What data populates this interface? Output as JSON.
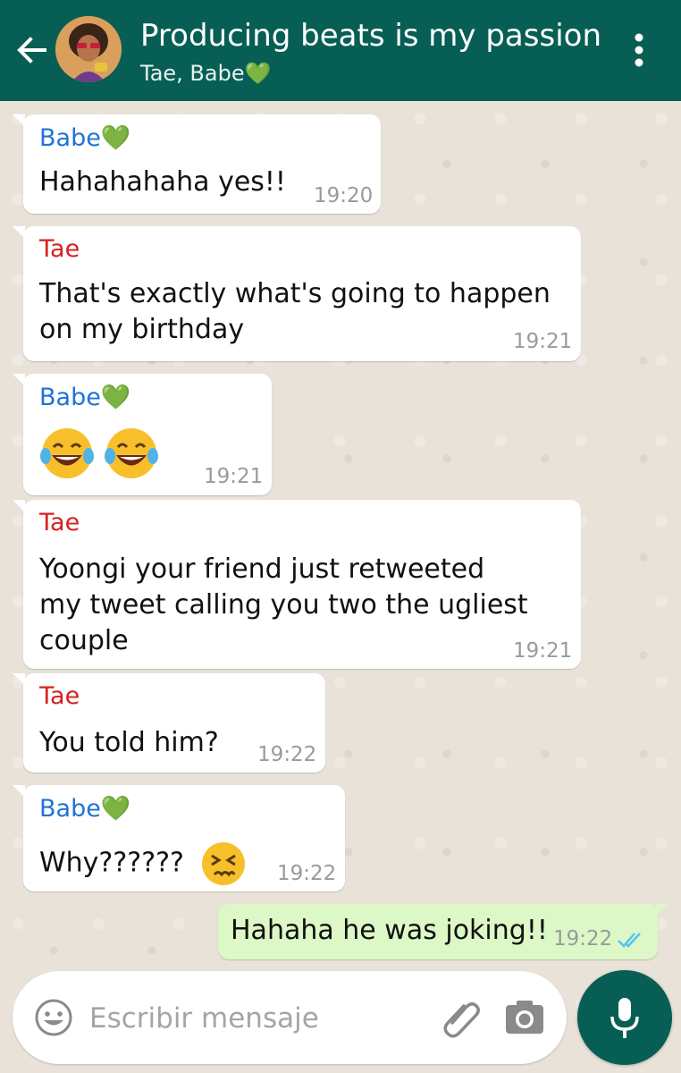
{
  "header": {
    "title": "Producing beats is my passion",
    "participants": "Tae, Babe💚"
  },
  "colors": {
    "header": "#075e54",
    "outgoing_bubble": "#dcf8c6",
    "incoming_bubble": "#ffffff",
    "sender_babe": "#1f73d6",
    "sender_tae": "#d5211f",
    "read_ticks": "#4fc3f7"
  },
  "messages": [
    {
      "sender": "Babe💚",
      "lines": [
        "Hahahahaha yes!!"
      ],
      "time": "19:20"
    },
    {
      "sender": "Tae",
      "lines": [
        "That's exactly what's going to happen",
        "on my birthday"
      ],
      "time": "19:21"
    },
    {
      "sender": "Babe💚",
      "emoji": "😂😂",
      "time": "19:21"
    },
    {
      "sender": "Tae",
      "lines": [
        "Yoongi your friend just retweeted",
        "my tweet calling you two the ugliest",
        "couple"
      ],
      "time": "19:21"
    },
    {
      "sender": "Tae",
      "lines": [
        "You told him?"
      ],
      "time": "19:22"
    },
    {
      "sender": "Babe💚",
      "lines": [
        "Why??????"
      ],
      "emoji": "😣",
      "time": "19:22"
    },
    {
      "outgoing": true,
      "lines": [
        "Hahaha he was joking!!"
      ],
      "time": "19:22",
      "status": "read"
    }
  ],
  "composer": {
    "placeholder": "Escribir mensaje"
  },
  "icons": [
    "back-arrow-icon",
    "more-options-icon",
    "emoji-icon",
    "attach-icon",
    "camera-icon",
    "mic-icon",
    "read-ticks-icon"
  ]
}
